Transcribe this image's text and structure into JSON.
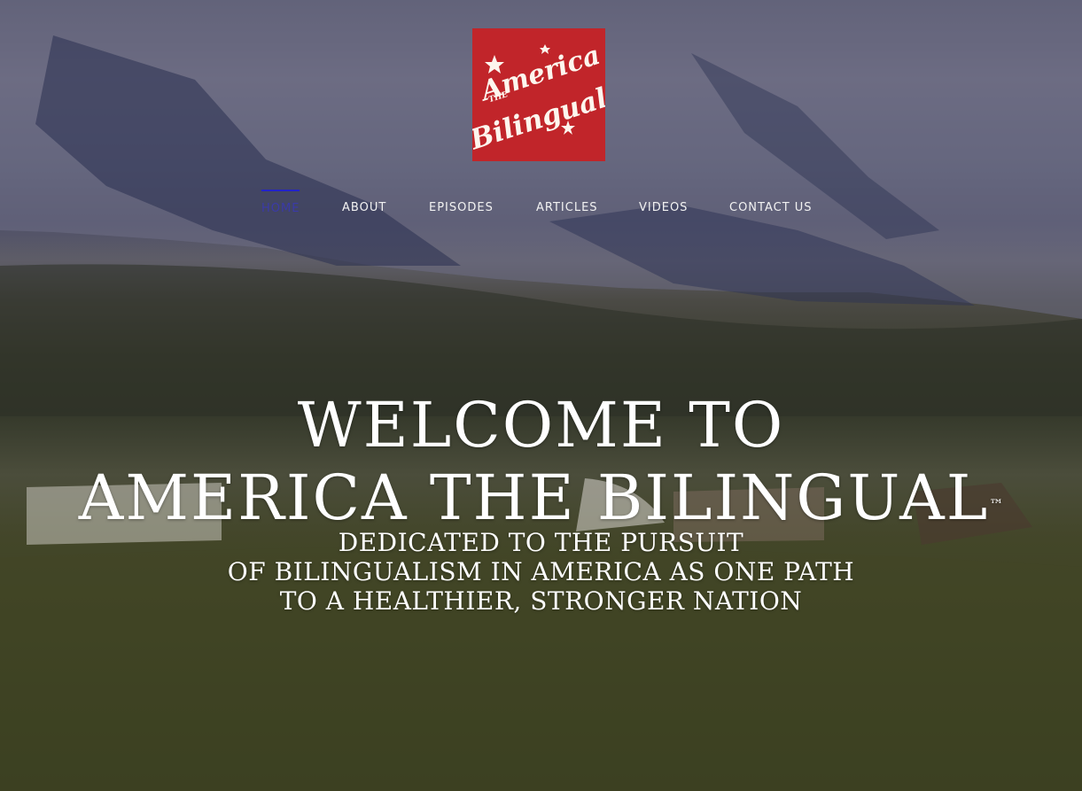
{
  "site": {
    "logo": {
      "line1": "America",
      "line2": "THE",
      "line3": "Bilingual",
      "color": "#c1252a"
    }
  },
  "nav": {
    "items": [
      {
        "label": "HOME",
        "active": true
      },
      {
        "label": "ABOUT"
      },
      {
        "label": "EPISODES"
      },
      {
        "label": "ARTICLES"
      },
      {
        "label": "VIDEOS"
      },
      {
        "label": "CONTACT US"
      }
    ],
    "active_color": "#2323c8"
  },
  "hero": {
    "title_line1": "WELCOME TO",
    "title_line2": "AMERICA THE BILINGUAL",
    "trademark": "™",
    "subtitle_line1": "DEDICATED TO THE PURSUIT",
    "subtitle_line2": "OF BILINGUALISM IN AMERICA AS ONE PATH",
    "subtitle_line3": "TO A HEALTHIER, STRONGER NATION"
  }
}
